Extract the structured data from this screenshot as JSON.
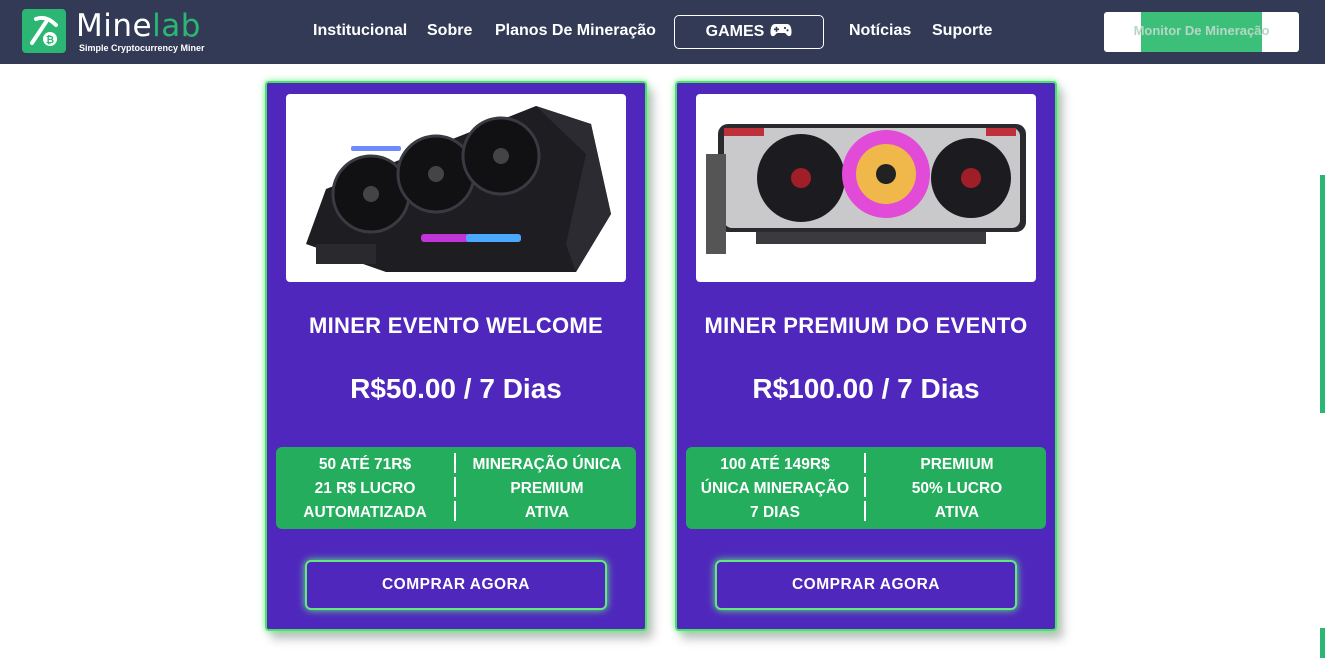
{
  "header": {
    "brand_name_a": "Mine",
    "brand_name_b": "lab",
    "brand_tagline": "Simple Cryptocurrency Miner",
    "nav": [
      "Institucional",
      "Sobre",
      "Planos De Mineração",
      "Notícias",
      "Suporte"
    ],
    "games_label": "GAMES",
    "monitor_label": "Monitor De Mineração"
  },
  "colors": {
    "header_bg": "#323a56",
    "brand_green": "#2bb673",
    "card_bg": "#4f27bd",
    "card_glow": "#4be06a",
    "feature_bg": "#23ad5c"
  },
  "cards": [
    {
      "image": "graphics-card-black-rgb",
      "title": "MINER EVENTO WELCOME",
      "price": "R$50.00 / 7 Dias",
      "features_left": [
        "50 ATÉ 71R$",
        "21 R$ LUCRO",
        "AUTOMATIZADA"
      ],
      "features_right": [
        "MINERAÇÃO ÚNICA",
        "PREMIUM",
        "ATIVA"
      ],
      "button": "COMPRAR AGORA"
    },
    {
      "image": "graphics-card-silver-rgb",
      "title": "MINER PREMIUM DO EVENTO",
      "price": "R$100.00 / 7 Dias",
      "features_left": [
        "100 ATÉ 149R$",
        "ÚNICA MINERAÇÃO",
        "7 DIAS"
      ],
      "features_right": [
        "PREMIUM",
        "50% LUCRO",
        "ATIVA"
      ],
      "button": "COMPRAR AGORA"
    }
  ]
}
